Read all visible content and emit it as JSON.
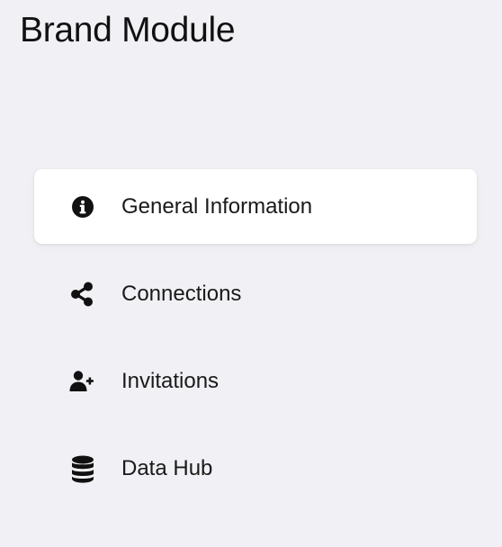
{
  "header": {
    "title": "Brand Module"
  },
  "menu": {
    "items": [
      {
        "label": "General Information",
        "icon": "info-circle-icon",
        "active": true
      },
      {
        "label": "Connections",
        "icon": "share-nodes-icon",
        "active": false
      },
      {
        "label": "Invitations",
        "icon": "user-plus-icon",
        "active": false
      },
      {
        "label": "Data Hub",
        "icon": "database-icon",
        "active": false
      }
    ]
  },
  "colors": {
    "background": "#f1f1f5",
    "active_item_background": "#ffffff",
    "text": "#111111",
    "icon": "#111111"
  }
}
